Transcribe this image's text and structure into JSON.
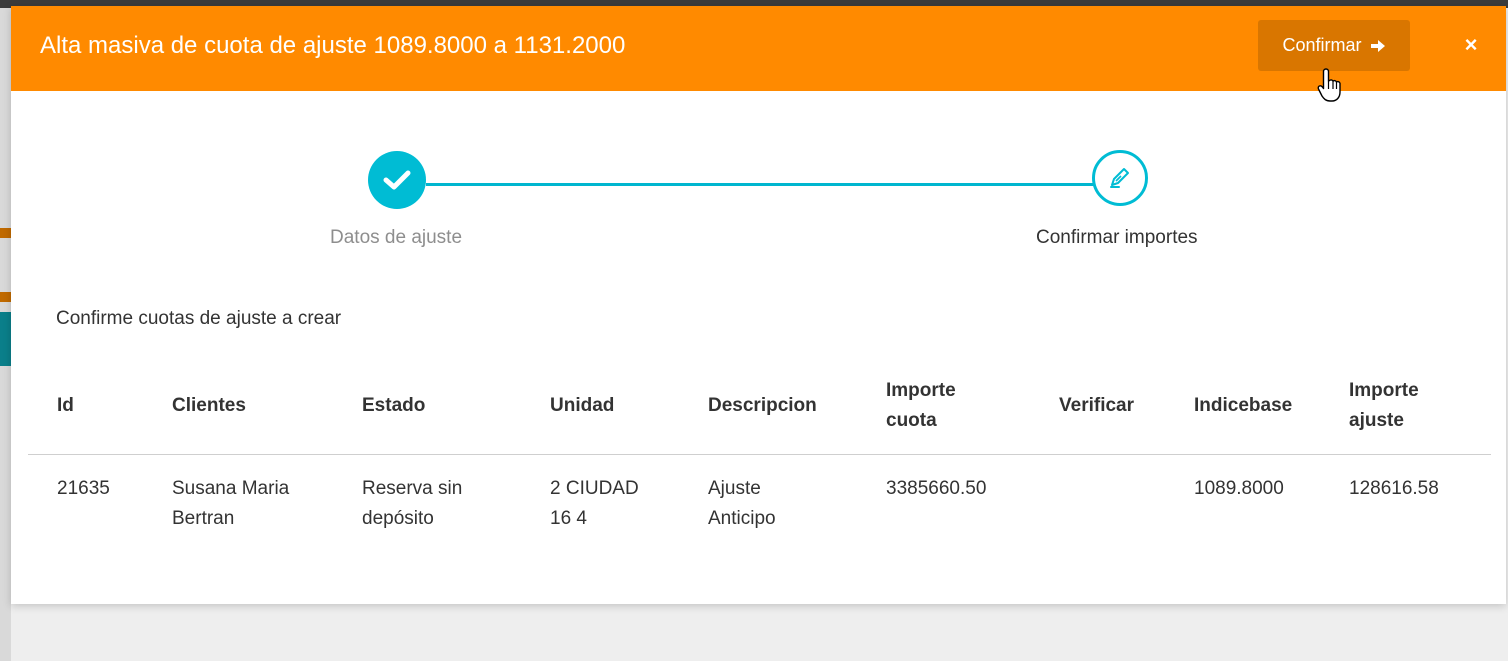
{
  "modal": {
    "title": "Alta masiva de cuota de ajuste 1089.8000 a 1131.2000",
    "confirm_label": "Confirmar",
    "close_label": "×",
    "header_color": "#ff8a00",
    "accent_color": "#00bcd4"
  },
  "stepper": {
    "steps": [
      {
        "label": "Datos de ajuste",
        "status": "done",
        "icon": "check-icon"
      },
      {
        "label": "Confirmar importes",
        "status": "active",
        "icon": "pencil-icon"
      }
    ]
  },
  "instruction": "Confirme cuotas de ajuste a crear",
  "table": {
    "headers": {
      "id": "Id",
      "clientes": "Clientes",
      "estado": "Estado",
      "unidad": "Unidad",
      "descripcion": "Descripcion",
      "importe_cuota_1": "Importe",
      "importe_cuota_2": "cuota",
      "verificar": "Verificar",
      "indicebase": "Indicebase",
      "importe_ajuste_1": "Importe",
      "importe_ajuste_2": "ajuste"
    },
    "rows": [
      {
        "id": "21635",
        "clientes_1": "Susana Maria",
        "clientes_2": "Bertran",
        "estado_1": "Reserva sin",
        "estado_2": "depósito",
        "unidad_1": "2 CIUDAD",
        "unidad_2": "16 4",
        "descripcion_1": "Ajuste",
        "descripcion_2": "Anticipo",
        "importe_cuota": "3385660.50",
        "verificar": "",
        "indicebase": "1089.8000",
        "importe_ajuste": "128616.58"
      }
    ]
  }
}
